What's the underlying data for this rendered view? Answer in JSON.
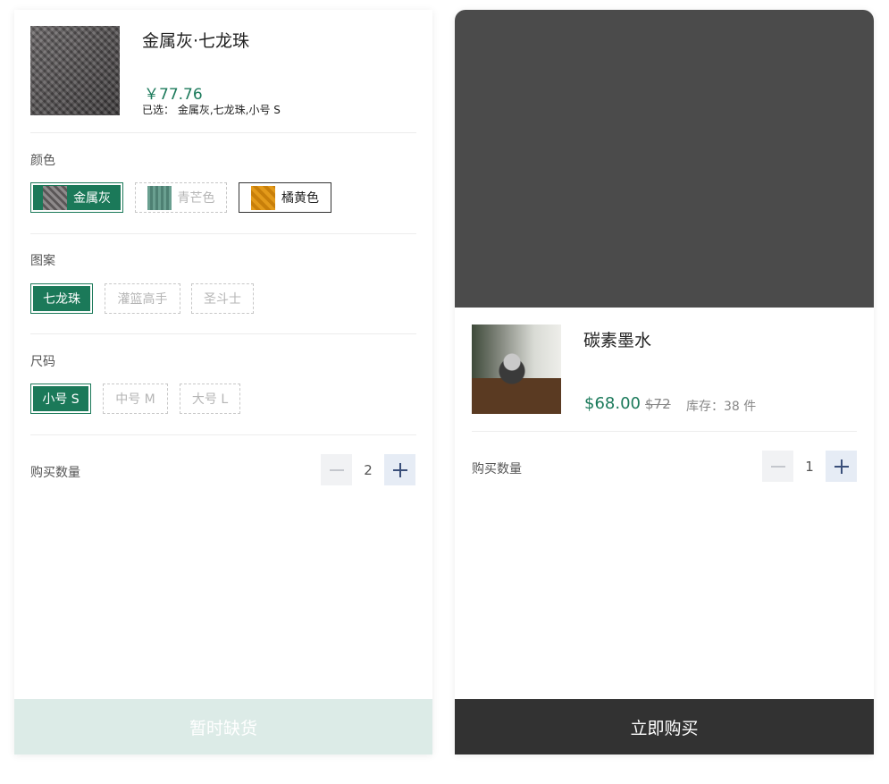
{
  "left": {
    "product": {
      "title": "金属灰·七龙珠",
      "price": "￥77.76",
      "selected_prefix": "已选：",
      "selected_value": "金属灰,七龙珠,小号 S"
    },
    "color": {
      "label": "颜色",
      "options": [
        {
          "label": "金属灰",
          "state": "selected"
        },
        {
          "label": "青芒色",
          "state": "disabled"
        },
        {
          "label": "橘黄色",
          "state": "available"
        }
      ]
    },
    "pattern": {
      "label": "图案",
      "options": [
        {
          "label": "七龙珠",
          "state": "selected"
        },
        {
          "label": "灌篮高手",
          "state": "disabled"
        },
        {
          "label": "圣斗士",
          "state": "disabled"
        }
      ]
    },
    "size": {
      "label": "尺码",
      "options": [
        {
          "label": "小号 S",
          "state": "selected"
        },
        {
          "label": "中号 M",
          "state": "disabled"
        },
        {
          "label": "大号 L",
          "state": "disabled"
        }
      ]
    },
    "quantity": {
      "label": "购买数量",
      "value": "2"
    },
    "action": {
      "label": "暂时缺货"
    }
  },
  "right": {
    "product": {
      "title": "碳素墨水",
      "price": "$68.00",
      "original_price": "$72",
      "stock": "库存：38 件"
    },
    "quantity": {
      "label": "购买数量",
      "value": "1"
    },
    "action": {
      "label": "立即购买"
    }
  },
  "icons": {
    "minus": "minus-icon",
    "plus": "plus-icon"
  },
  "colors": {
    "accent": "#1b7959",
    "price": "#1c7a5b",
    "buy_button": "#323232",
    "disabled_button": "#dcebe7"
  }
}
